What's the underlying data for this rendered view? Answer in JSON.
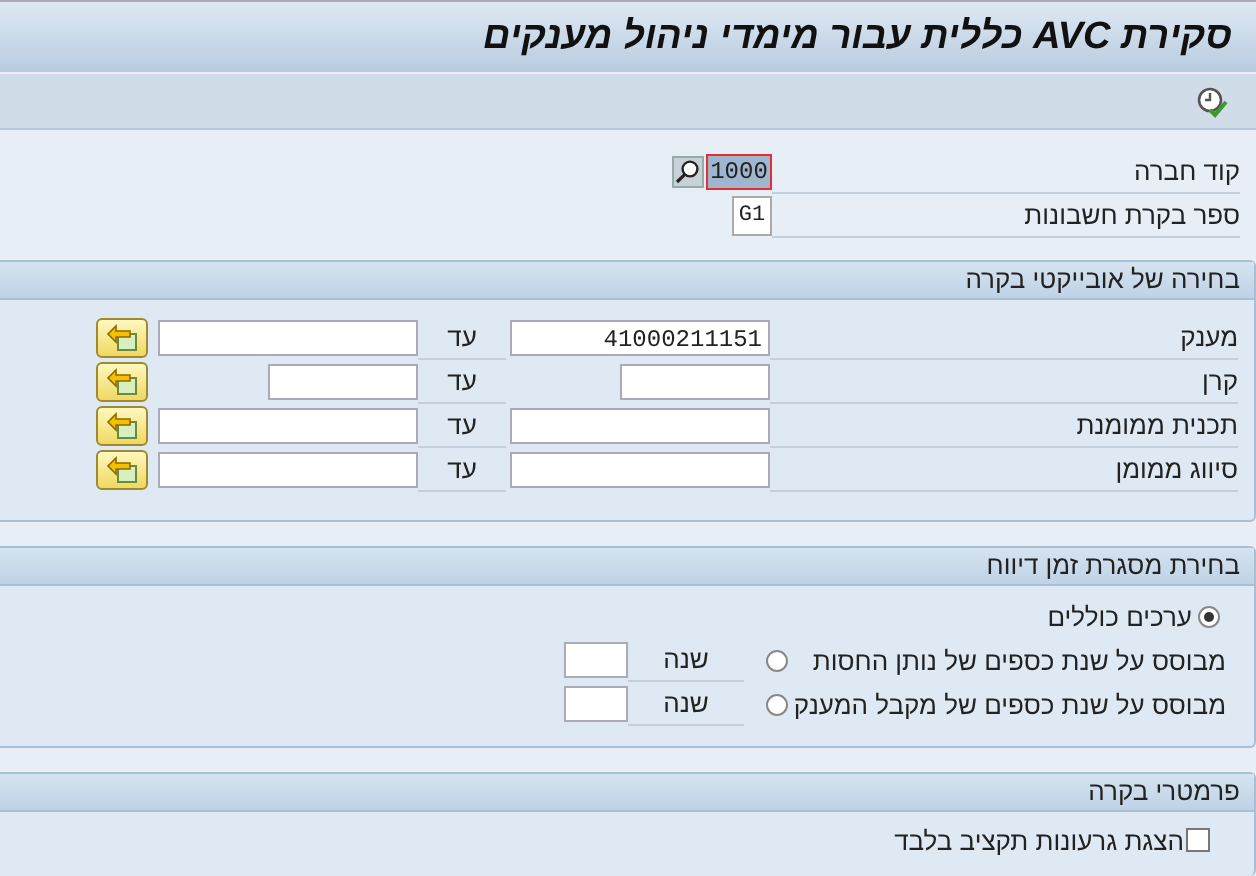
{
  "window": {
    "title": "סקירת AVC כללית עבור מימדי ניהול מענקים"
  },
  "toolbar": {
    "buttons": [
      {
        "kind": "execute"
      }
    ]
  },
  "header_fields": [
    {
      "label": "קוד חברה",
      "value": "1000",
      "kind": "search"
    },
    {
      "label": "ספר בקרת חשבונות",
      "value": "G1",
      "kind": "plain"
    }
  ],
  "object_selection": {
    "title": "בחירה של אובייקטי בקרה",
    "rows": [
      {
        "label": "מענק",
        "from": "41000211151",
        "to_label": "עד",
        "kind": "long"
      },
      {
        "label": "קרן",
        "to_label": "עד",
        "kind": "short"
      },
      {
        "label": "תכנית ממומנת",
        "to_label": "עד",
        "kind": "long"
      },
      {
        "label": "סיווג ממומן",
        "to_label": "עד",
        "kind": "long"
      }
    ]
  },
  "time_frame": {
    "title": "בחירת מסגרת זמן דיווח",
    "options": [
      {
        "label": "ערכים כוללים",
        "selected": true,
        "kind": "plain"
      },
      {
        "label": "מבוסס על שנת כספים של נותן החסות",
        "selected": false,
        "kind": "year",
        "year_label": "שנה"
      },
      {
        "label": "מבוסס על שנת כספים של מקבל המענק",
        "selected": false,
        "kind": "year",
        "year_label": "שנה"
      }
    ]
  },
  "control_parameters": {
    "title": "פרמטרי בקרה",
    "checkboxes": [
      {
        "label": "הצגת גרעונות תקציב בלבד",
        "checked": false
      }
    ]
  }
}
